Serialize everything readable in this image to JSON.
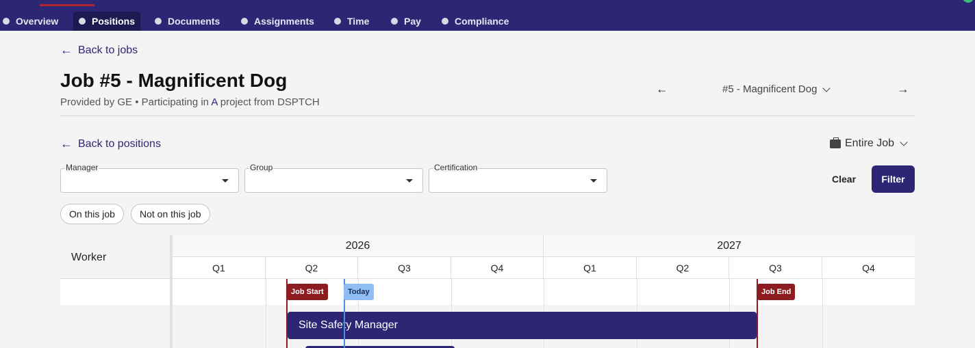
{
  "nav": {
    "tabs": [
      {
        "label": "Overview",
        "active": false
      },
      {
        "label": "Positions",
        "active": true
      },
      {
        "label": "Documents",
        "active": false
      },
      {
        "label": "Assignments",
        "active": false
      },
      {
        "label": "Time",
        "active": false
      },
      {
        "label": "Pay",
        "active": false
      },
      {
        "label": "Compliance",
        "active": false
      }
    ]
  },
  "back_to_jobs": "Back to jobs",
  "job": {
    "title": "Job #5 - Magnificent Dog",
    "provided_by": "Provided by GE • Participating in ",
    "project_link": "A",
    "project_suffix": " project from DSPTCH",
    "selector_value": "#5 - Magnificent Dog"
  },
  "back_to_positions": "Back to positions",
  "scope_label": "Entire Job",
  "filters": {
    "manager_label": "Manager",
    "group_label": "Group",
    "certification_label": "Certification",
    "clear_label": "Clear",
    "filter_label": "Filter"
  },
  "chips": [
    "On this job",
    "Not on this job"
  ],
  "gantt": {
    "worker_header": "Worker",
    "years": [
      "2026",
      "2027"
    ],
    "quarters": [
      "Q1",
      "Q2",
      "Q3",
      "Q4",
      "Q1",
      "Q2",
      "Q3",
      "Q4"
    ],
    "job_start_label": "Job Start",
    "today_label": "Today",
    "job_end_label": "Job End",
    "position_bar_label": "Site Safety Manager"
  },
  "colors": {
    "brand": "#2d2675",
    "job_marker": "#8c1c20",
    "today": "#8fbef5"
  }
}
